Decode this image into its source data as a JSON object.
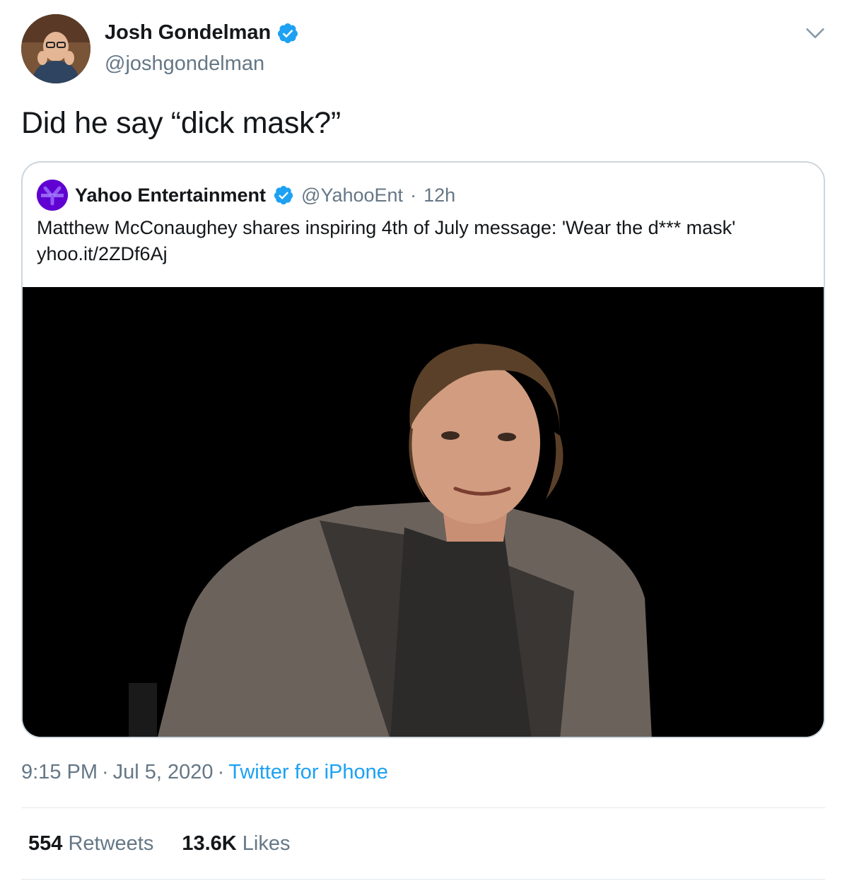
{
  "author": {
    "name": "Josh Gondelman",
    "handle": "@joshgondelman",
    "verified": true,
    "avatar_icon": "user-avatar"
  },
  "tweet": {
    "text": "Did he say “dick mask?”"
  },
  "quoted_tweet": {
    "name": "Yahoo Entertainment",
    "handle": "@YahooEnt",
    "separator": "·",
    "time": "12h",
    "text": "Matthew McConaughey shares inspiring 4th of July message: 'Wear the d*** mask' yhoo.it/2ZDf6Aj",
    "avatar_icon": "yahoo-entertainment-logo"
  },
  "meta": {
    "time": "9:15 PM",
    "sep1": "·",
    "date": "Jul 5, 2020",
    "sep2": "·",
    "source": "Twitter for iPhone"
  },
  "stats": {
    "retweets_count": "554",
    "retweets_label": "Retweets",
    "likes_count": "13.6K",
    "likes_label": "Likes"
  },
  "colors": {
    "verified_blue": "#1da1f2",
    "text_primary": "#14171a",
    "text_secondary": "#657786",
    "border": "#ccd6dd"
  }
}
